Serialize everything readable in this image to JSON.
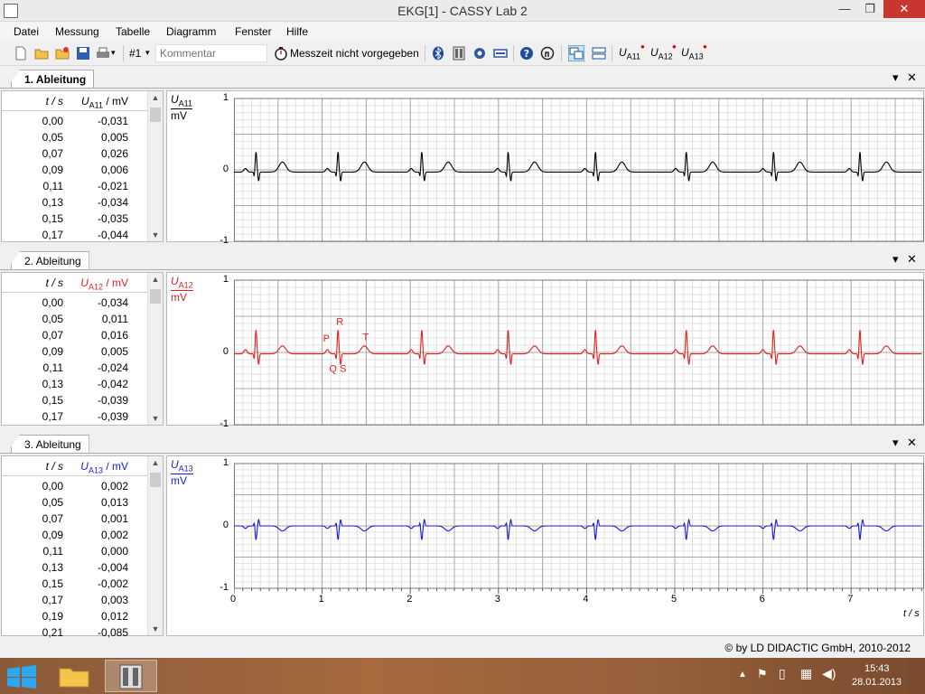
{
  "window": {
    "title": "EKG[1] - CASSY Lab 2",
    "minimize": "—",
    "restore": "❐",
    "close": "✕"
  },
  "menu": [
    "Datei",
    "Messung",
    "Tabelle",
    "Diagramm",
    "Fenster",
    "Hilfe"
  ],
  "toolbar": {
    "measurement_number": "#1",
    "comment_placeholder": "Kommentar",
    "measurement_time": "Messzeit nicht vorgegeben",
    "channel_buttons": [
      {
        "u": "U",
        "sub": "A11"
      },
      {
        "u": "U",
        "sub": "A12"
      },
      {
        "u": "U",
        "sub": "A13"
      }
    ]
  },
  "panels": [
    {
      "tab": "1. Ableitung",
      "color": "#000000",
      "table": {
        "col1_header": "t / s",
        "col2_header_symbol": "U",
        "col2_header_sub": "A11",
        "col2_header_unit": " / mV",
        "rows": [
          [
            "0,00",
            "-0,031"
          ],
          [
            "0,05",
            "0,005"
          ],
          [
            "0,07",
            "0,026"
          ],
          [
            "0,09",
            "0,006"
          ],
          [
            "0,11",
            "-0,021"
          ],
          [
            "0,13",
            "-0,034"
          ],
          [
            "0,15",
            "-0,035"
          ],
          [
            "0,17",
            "-0,044"
          ]
        ]
      },
      "axis": {
        "symbol": "U",
        "sub": "A11",
        "unit": "mV",
        "ticks": [
          "1",
          "0",
          "-1"
        ]
      },
      "annotations": []
    },
    {
      "tab": "2. Ableitung",
      "color": "#e02020",
      "table": {
        "col1_header": "t / s",
        "col2_header_symbol": "U",
        "col2_header_sub": "A12",
        "col2_header_unit": " / mV",
        "rows": [
          [
            "0,00",
            "-0,034"
          ],
          [
            "0,05",
            "0,011"
          ],
          [
            "0,07",
            "0,016"
          ],
          [
            "0,09",
            "0,005"
          ],
          [
            "0,11",
            "-0,024"
          ],
          [
            "0,13",
            "-0,042"
          ],
          [
            "0,15",
            "-0,039"
          ],
          [
            "0,17",
            "-0,039"
          ]
        ]
      },
      "axis": {
        "symbol": "U",
        "sub": "A12",
        "unit": "mV",
        "ticks": [
          "1",
          "0",
          "-1"
        ]
      },
      "annotations": [
        "P",
        "R",
        "T",
        "Q",
        "S"
      ]
    },
    {
      "tab": "3. Ableitung",
      "color": "#1a1adc",
      "table": {
        "col1_header": "t / s",
        "col2_header_symbol": "U",
        "col2_header_sub": "A13",
        "col2_header_unit": " / mV",
        "rows": [
          [
            "0,00",
            "0,002"
          ],
          [
            "0,05",
            "0,013"
          ],
          [
            "0,07",
            "0,001"
          ],
          [
            "0,09",
            "0,002"
          ],
          [
            "0,11",
            "0,000"
          ],
          [
            "0,13",
            "-0,004"
          ],
          [
            "0,15",
            "-0,002"
          ],
          [
            "0,17",
            "0,003"
          ],
          [
            "0,19",
            "0,012"
          ],
          [
            "0,21",
            "-0,085"
          ]
        ]
      },
      "axis": {
        "symbol": "U",
        "sub": "A13",
        "unit": "mV",
        "ticks": [
          "1",
          "0",
          "-1"
        ]
      },
      "annotations": []
    }
  ],
  "chart_data": {
    "type": "line",
    "x_label": "t / s",
    "x_ticks": [
      "0",
      "1",
      "2",
      "3",
      "4",
      "5",
      "6",
      "7"
    ],
    "xlim": [
      0,
      7.8
    ],
    "ylim": [
      -1,
      1
    ],
    "grid": true,
    "beats_s": [
      0.25,
      1.18,
      2.13,
      3.11,
      4.1,
      5.13,
      6.12,
      7.1
    ],
    "series": [
      {
        "name": "U A11",
        "color": "#000000",
        "r_peak_mV": 0.28,
        "t_peak_mV": 0.14,
        "baseline_mV": -0.03
      },
      {
        "name": "U A12",
        "color": "#e02020",
        "r_peak_mV": 0.33,
        "t_peak_mV": 0.11,
        "baseline_mV": -0.02
      },
      {
        "name": "U A13",
        "color": "#1a1adc",
        "r_peak_mV": -0.22,
        "t_peak_mV": -0.08,
        "baseline_mV": 0.0
      }
    ]
  },
  "status": {
    "copyright": "©  by LD DIDACTIC GmbH, 2010-2012"
  },
  "taskbar": {
    "time": "15:43",
    "date": "28.01.2013"
  }
}
